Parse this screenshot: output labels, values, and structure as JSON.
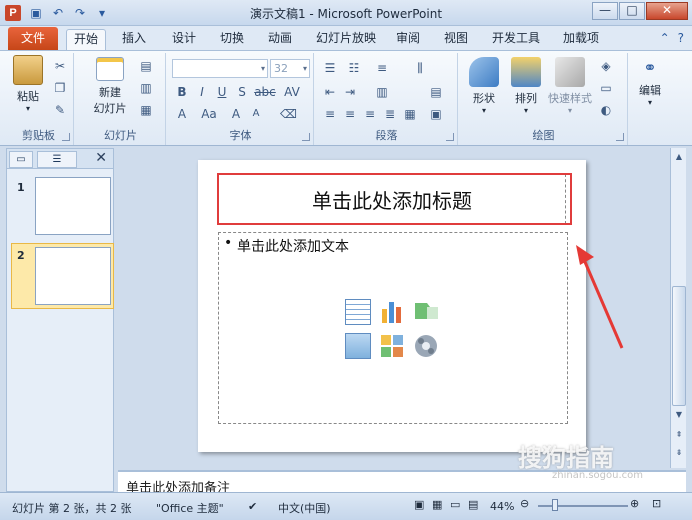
{
  "window": {
    "app_icon": "P",
    "title": "演示文稿1 - Microsoft PowerPoint",
    "minimize": "—",
    "maximize": "□",
    "close": "✕"
  },
  "tabs": {
    "file": "文件",
    "items": [
      "开始",
      "插入",
      "设计",
      "切换",
      "动画",
      "幻灯片放映",
      "审阅",
      "视图",
      "开发工具",
      "加载项"
    ],
    "active": "开始"
  },
  "ribbon": {
    "clipboard": {
      "label": "剪贴板",
      "paste": "粘贴"
    },
    "slides": {
      "label": "幻灯片",
      "new_slide": "新建",
      "new_slide_2": "幻灯片"
    },
    "font": {
      "label": "字体",
      "font_size": "32"
    },
    "paragraph": {
      "label": "段落"
    },
    "drawing": {
      "label": "绘图",
      "shapes": "形状",
      "arrange": "排列",
      "quick_styles": "快速样式"
    },
    "editing": {
      "label": "编辑"
    }
  },
  "left_pane": {
    "slide_numbers": [
      "1",
      "2"
    ],
    "close": "✕"
  },
  "slide": {
    "title_placeholder": "单击此处添加标题",
    "bullet": "•",
    "body_placeholder": "单击此处添加文本"
  },
  "notes": {
    "placeholder": "单击此处添加备注"
  },
  "status": {
    "slide_info": "幻灯片 第 2 张，共 2 张",
    "theme": "\"Office 主题\"",
    "language": "中文(中国)",
    "zoom": "44%"
  },
  "watermark": {
    "text": "搜狗指南",
    "url": "zhinan.sogou.com"
  },
  "colors": {
    "file_tab": "#d3501f",
    "highlight": "#e03c3c",
    "arrow": "#e53935"
  }
}
